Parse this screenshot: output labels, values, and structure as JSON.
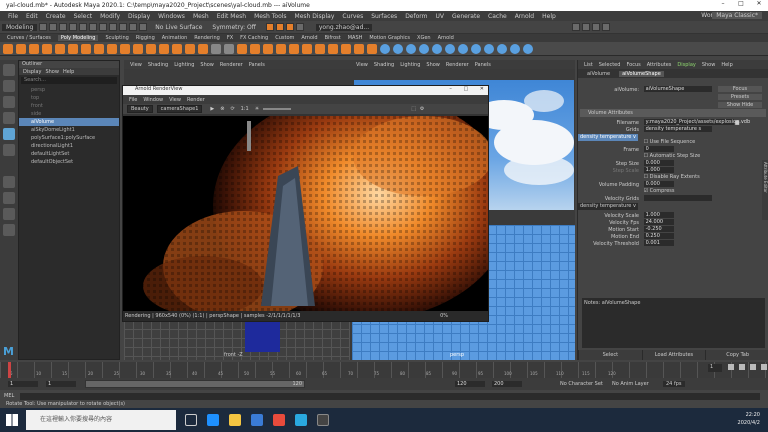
{
  "app": {
    "title": "yal-cloud.mb* - Autodesk Maya 2020.1: C:\\temp\\maya2020_Project\\scenes\\yal-cloud.mb  ---  aiVolume"
  },
  "menubar": {
    "items": [
      "File",
      "Edit",
      "Create",
      "Select",
      "Modify",
      "Display",
      "Windows",
      "Mesh",
      "Edit Mesh",
      "Mesh Tools",
      "Mesh Display",
      "Curves",
      "Surfaces",
      "Deform",
      "UV",
      "Generate",
      "Cache",
      "Arnold",
      "Help"
    ],
    "workspace_label": "Workspace :",
    "workspace_value": "Maya Classic*"
  },
  "statusline": {
    "mode": "Modeling",
    "live": "No Live Surface",
    "symmetry": "Symmetry: Off",
    "user": "yong.zhao@ad..."
  },
  "shelf": {
    "tabs": [
      "Curves / Surfaces",
      "Poly Modeling",
      "Sculpting",
      "Rigging",
      "Animation",
      "Rendering",
      "FX",
      "FX Caching",
      "Custom",
      "Arnold",
      "Bifrost",
      "MASH",
      "Motion Graphics",
      "XGen",
      "Arnold"
    ],
    "active_index": 1
  },
  "outliner": {
    "title": "Outliner",
    "menu": [
      "Display",
      "Show",
      "Help"
    ],
    "search_placeholder": "Search...",
    "items": [
      {
        "label": "persp",
        "state": "dim"
      },
      {
        "label": "top",
        "state": "dim"
      },
      {
        "label": "front",
        "state": "dim"
      },
      {
        "label": "side",
        "state": "dim"
      },
      {
        "label": "aiVolume",
        "state": "sel"
      },
      {
        "label": "aiSkyDomeLight1",
        "state": "normal"
      },
      {
        "label": "polySurface1:polySurface",
        "state": "normal"
      },
      {
        "label": "directionalLight1",
        "state": "normal"
      },
      {
        "label": "defaultLightSet",
        "state": "normal"
      },
      {
        "label": "defaultObjectSet",
        "state": "normal"
      }
    ]
  },
  "viewport_menu": [
    "View",
    "Shading",
    "Lighting",
    "Show",
    "Renderer",
    "Panels"
  ],
  "viewport_labels": {
    "left_bottom": "front -Z",
    "right_bottom": "persp"
  },
  "renderview": {
    "title": "Arnold RenderView",
    "menu": [
      "File",
      "Window",
      "View",
      "Render"
    ],
    "mode": "Beauty",
    "camera": "cameraShape1",
    "ratio": "1:1",
    "status": "Rendering | 960x540 (0%) (1:1) | perspShape | samples -2/1/1/1/1/1/3",
    "zoom": "0%"
  },
  "attribute_editor": {
    "menu": [
      "List",
      "Selected",
      "Focus",
      "Attributes",
      "Display",
      "Show",
      "Help"
    ],
    "tabs": [
      "aiVolume",
      "aiVolumeShape"
    ],
    "node_label": "aiVolume:",
    "node_value": "aiVolumeShape",
    "buttons_side": [
      "Focus",
      "Presets",
      "Show  Hide"
    ],
    "section": "Volume Attributes",
    "fields": [
      {
        "label": "Filename",
        "value": "y:maya2020_Project/assets/explosion.vdb"
      },
      {
        "label": "Grids",
        "value": "density temperature s"
      },
      {
        "label": "",
        "value": "Use File Sequence"
      },
      {
        "label": "Frame",
        "value": "0"
      },
      {
        "label": "",
        "value": "Automatic Step Size"
      },
      {
        "label": "Step Size",
        "value": "0.000"
      },
      {
        "label": "Step Scale",
        "value": "1.000"
      },
      {
        "label": "",
        "value": "Disable Ray Extents"
      },
      {
        "label": "Volume Padding",
        "value": "0.000"
      },
      {
        "label": "",
        "value": "Compress"
      },
      {
        "label": "Velocity Grids",
        "value": ""
      },
      {
        "label": "Velocity Scale",
        "value": "1.000"
      },
      {
        "label": "Velocity Fps",
        "value": "24.000"
      },
      {
        "label": "Motion Start",
        "value": "-0.250"
      },
      {
        "label": "Motion End",
        "value": "0.250"
      },
      {
        "label": "Velocity Threshold",
        "value": "0.001"
      }
    ],
    "grid_list": "density temperature v",
    "vgrid_list": "density temperature v",
    "notes_label": "Notes:  aiVolumeShape",
    "bottom_buttons": [
      "Select",
      "Load Attributes",
      "Copy Tab"
    ],
    "side_tab": "Attribute Editor"
  },
  "timeline": {
    "ticks": [
      "5",
      "10",
      "15",
      "20",
      "25",
      "30",
      "35",
      "40",
      "45",
      "50",
      "55",
      "60",
      "65",
      "70",
      "75",
      "80",
      "85",
      "90",
      "95",
      "100",
      "105",
      "110",
      "115",
      "120"
    ],
    "current": "1"
  },
  "range": {
    "start": "1",
    "start2": "1",
    "bar_end": "120",
    "end": "120",
    "end2": "200",
    "character_set": "No Character Set",
    "anim_layer": "No Anim Layer",
    "fps": "24 fps"
  },
  "mel": {
    "label": "MEL",
    "hint": "Rotate Tool: Use manipulator to rotate object(s)"
  },
  "taskbar": {
    "search_placeholder": "在這裡輸入你要搜尋的內容",
    "time": "22:20",
    "date": "2020/4/2"
  }
}
